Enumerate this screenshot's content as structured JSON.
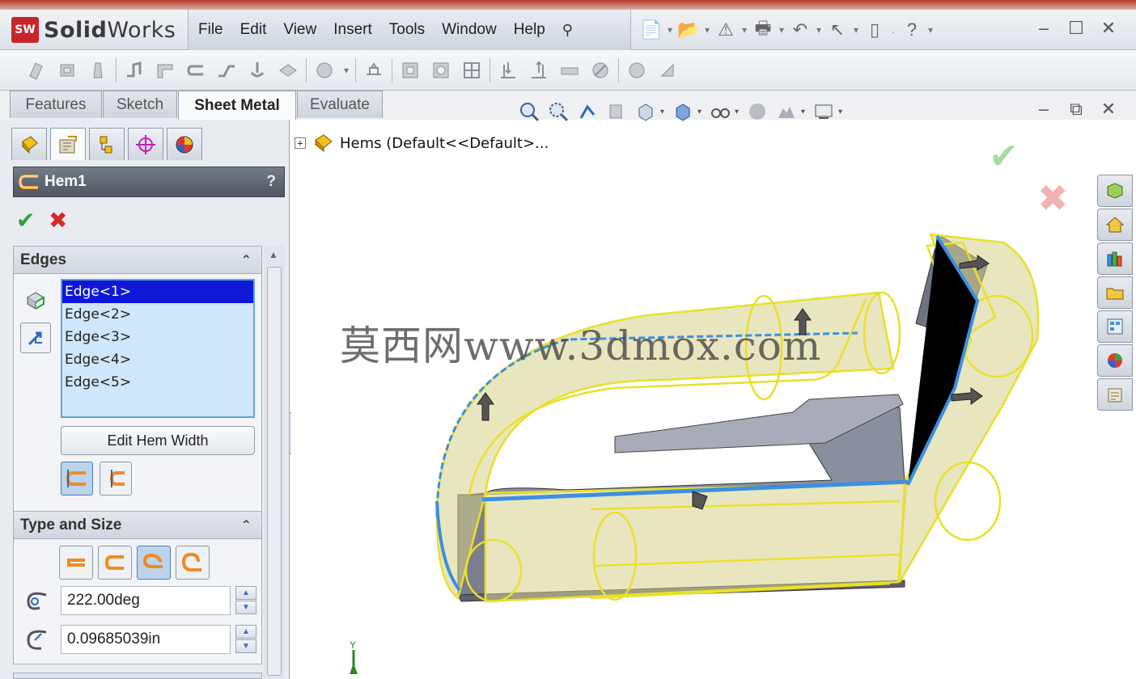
{
  "app": {
    "logo_mark": "SW",
    "logo_name_bold": "Solid",
    "logo_name_thin": "Works"
  },
  "menu": {
    "items": [
      "File",
      "Edit",
      "View",
      "Insert",
      "Tools",
      "Window",
      "Help"
    ]
  },
  "tabs": [
    {
      "label": "Features",
      "active": false
    },
    {
      "label": "Sketch",
      "active": false
    },
    {
      "label": "Sheet Metal",
      "active": true
    },
    {
      "label": "Evaluate",
      "active": false
    }
  ],
  "property_manager": {
    "title": "Hem1",
    "help_glyph": "?",
    "edges_group": {
      "title": "Edges",
      "edges": [
        "Edge<1>",
        "Edge<2>",
        "Edge<3>",
        "Edge<4>",
        "Edge<5>"
      ],
      "selected_index": 0,
      "edit_hem_width_label": "Edit Hem Width"
    },
    "type_group": {
      "title": "Type and Size",
      "angle_value": "222.00deg",
      "radius_value": "0.09685039in"
    }
  },
  "graphics": {
    "tree_root_label": "Hems  (Default<<Default>...",
    "watermark": "莫西网www.3dmox.com",
    "triad_label": "Y"
  },
  "colors": {
    "selection_blue": "#1018d8",
    "list_bg": "#cfe7fb",
    "ok_green": "#2ea13d",
    "cancel_red": "#d42a2a",
    "preview_yellow": "#f2ee2a",
    "edge_blue": "#3d8fe0"
  }
}
